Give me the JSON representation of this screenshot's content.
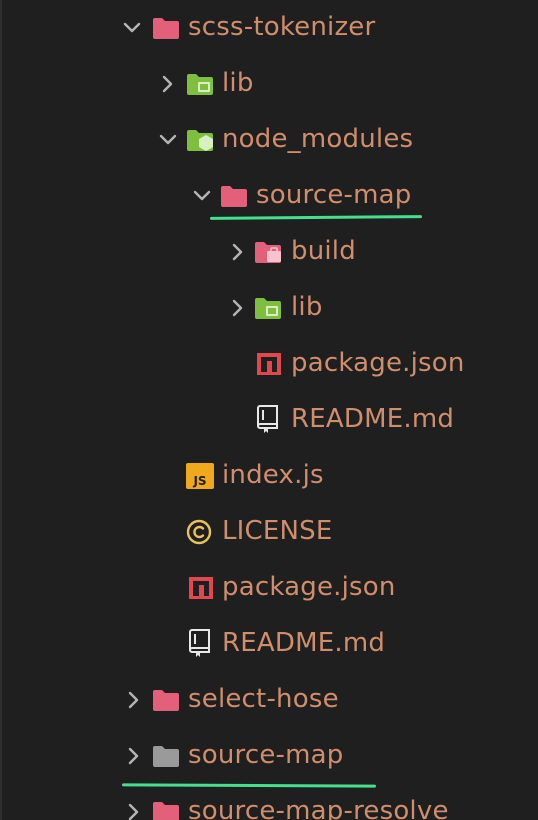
{
  "colors": {
    "background": "#1f1f1f",
    "label": "#cf8e6d",
    "folder_pink": "#e3607a",
    "folder_green": "#7fbf3f",
    "folder_gray": "#9a9a9a",
    "npm_red": "#e0474f",
    "js_yellow": "#f0a81c",
    "license_yellow": "#e8c35a",
    "underline": "#44e08f"
  },
  "tree": {
    "items": [
      {
        "label": "scss-tokenizer",
        "icon": "folder-open-icon",
        "expanded": true
      },
      {
        "label": "lib",
        "icon": "folder-lib-icon",
        "expanded": false
      },
      {
        "label": "node_modules",
        "icon": "folder-node-modules-icon",
        "expanded": true
      },
      {
        "label": "source-map",
        "icon": "folder-open-icon",
        "expanded": true,
        "highlighted": true
      },
      {
        "label": "build",
        "icon": "folder-build-icon",
        "expanded": false
      },
      {
        "label": "lib",
        "icon": "folder-lib-icon",
        "expanded": false
      },
      {
        "label": "package.json",
        "icon": "npm-icon"
      },
      {
        "label": "README.md",
        "icon": "readme-book-icon"
      },
      {
        "label": "index.js",
        "icon": "js-icon"
      },
      {
        "label": "LICENSE",
        "icon": "license-icon"
      },
      {
        "label": "package.json",
        "icon": "npm-icon"
      },
      {
        "label": "README.md",
        "icon": "readme-book-icon"
      },
      {
        "label": "select-hose",
        "icon": "folder-icon",
        "expanded": false
      },
      {
        "label": "source-map",
        "icon": "folder-gray-icon",
        "expanded": false,
        "highlighted": true
      },
      {
        "label": "source-map-resolve",
        "icon": "folder-icon",
        "expanded": false
      }
    ]
  }
}
